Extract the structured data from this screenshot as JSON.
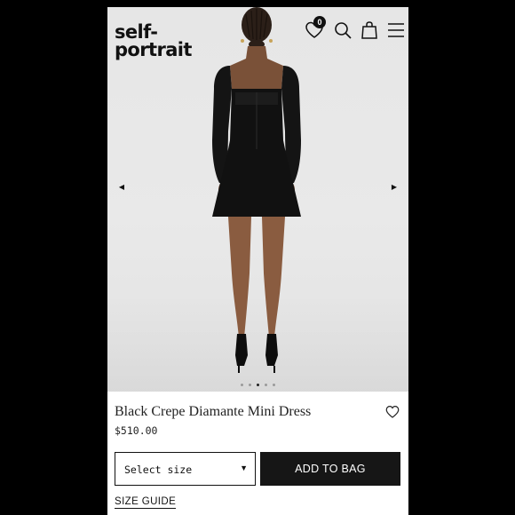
{
  "brand": {
    "logo_line1": "self-",
    "logo_line2": "portrait"
  },
  "header": {
    "wishlist_count": "0"
  },
  "gallery": {
    "slide_count": 5,
    "active_slide": 3
  },
  "product": {
    "title": "Black Crepe Diamante Mini Dress",
    "price": "$510.00"
  },
  "purchase": {
    "size_select_label": "Select size",
    "add_to_bag_label": "ADD TO BAG",
    "size_guide_label": "SIZE GUIDE"
  },
  "icons": {
    "wishlist": "heart-icon",
    "search": "search-icon",
    "bag": "shopping-bag-icon",
    "menu": "hamburger-menu-icon",
    "prev": "arrow-left-icon",
    "next": "arrow-right-icon",
    "caret": "caret-down-icon"
  },
  "colors": {
    "page_background": "#000000",
    "button_background": "#161616",
    "image_background": "#e6e6e6"
  }
}
